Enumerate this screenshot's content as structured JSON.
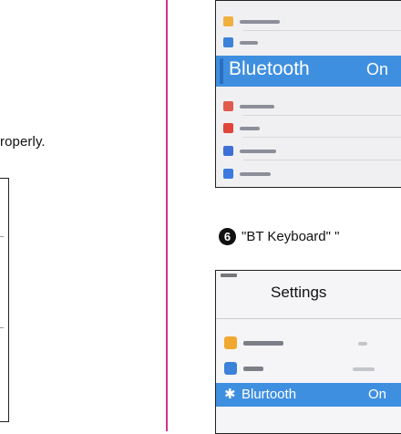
{
  "left_column": {
    "snippet": "roperly."
  },
  "screenshot_top": {
    "highlighted_item": {
      "label": "Bluetooth",
      "state": "On"
    },
    "colors": {
      "highlight": "#3f8fe0",
      "row_icons": [
        "#f0b040",
        "#3b82d8",
        "#e05a4e",
        "#e0443a",
        "#3e6fd6",
        "#3b7ae0"
      ]
    }
  },
  "caption": {
    "step_number": "6",
    "text": "\"BT Keyboard\" \""
  },
  "screenshot_bottom": {
    "title": "Settings",
    "items": [
      {
        "icon": "airplane-icon",
        "color": "#f0a830"
      },
      {
        "icon": "wifi-icon",
        "color": "#3b82d8"
      }
    ],
    "bluetooth_item": {
      "icon": "bluetooth-icon",
      "glyph": "✱",
      "label": "Blurtooth",
      "state": "On"
    }
  }
}
